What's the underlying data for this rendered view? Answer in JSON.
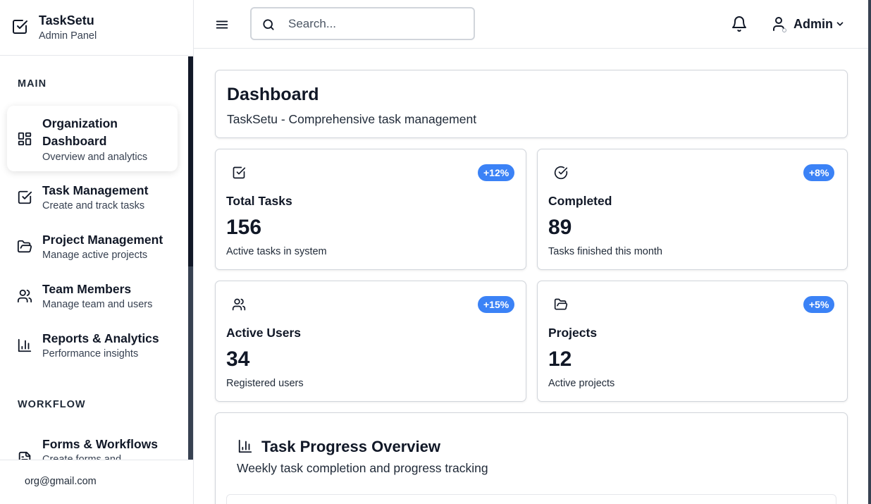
{
  "brand": {
    "title": "TaskSetu",
    "subtitle": "Admin Panel",
    "icon": "square-check-icon"
  },
  "sidebar": {
    "sections": [
      {
        "label": "MAIN"
      },
      {
        "label": "WORKFLOW"
      }
    ],
    "items": [
      {
        "title_line1": "Organization",
        "title_line2": "Dashboard",
        "subtitle": "Overview and analytics",
        "icon": "layout-grid-icon",
        "active": true
      },
      {
        "title": "Task Management",
        "subtitle": "Create and track tasks",
        "icon": "square-check-icon"
      },
      {
        "title": "Project Management",
        "subtitle": "Manage active projects",
        "icon": "folder-open-icon"
      },
      {
        "title": "Team Members",
        "subtitle": "Manage team and users",
        "icon": "users-icon"
      },
      {
        "title": "Reports & Analytics",
        "subtitle": "Performance insights",
        "icon": "bar-chart-icon"
      },
      {
        "title": "Forms & Workflows",
        "subtitle": "Create forms and",
        "icon": "file-text-icon"
      }
    ],
    "footer_email": "org@gmail.com"
  },
  "topbar": {
    "search_placeholder": "Search...",
    "user_name": "Admin"
  },
  "header": {
    "title": "Dashboard",
    "subtitle": "TaskSetu - Comprehensive task management"
  },
  "stats": [
    {
      "icon": "square-check-icon",
      "badge": "+12%",
      "title": "Total Tasks",
      "value": "156",
      "desc": "Active tasks in system"
    },
    {
      "icon": "circle-check-icon",
      "badge": "+8%",
      "title": "Completed",
      "value": "89",
      "desc": "Tasks finished this month"
    },
    {
      "icon": "users-icon",
      "badge": "+15%",
      "title": "Active Users",
      "value": "34",
      "desc": "Registered users"
    },
    {
      "icon": "folder-open-icon",
      "badge": "+5%",
      "title": "Projects",
      "value": "12",
      "desc": "Active projects"
    }
  ],
  "progress": {
    "title": "Task Progress Overview",
    "subtitle": "Weekly task completion and progress tracking",
    "icon": "bar-chart-icon"
  },
  "colors": {
    "accent": "#3b82f6",
    "scrollbar": "#374151"
  }
}
